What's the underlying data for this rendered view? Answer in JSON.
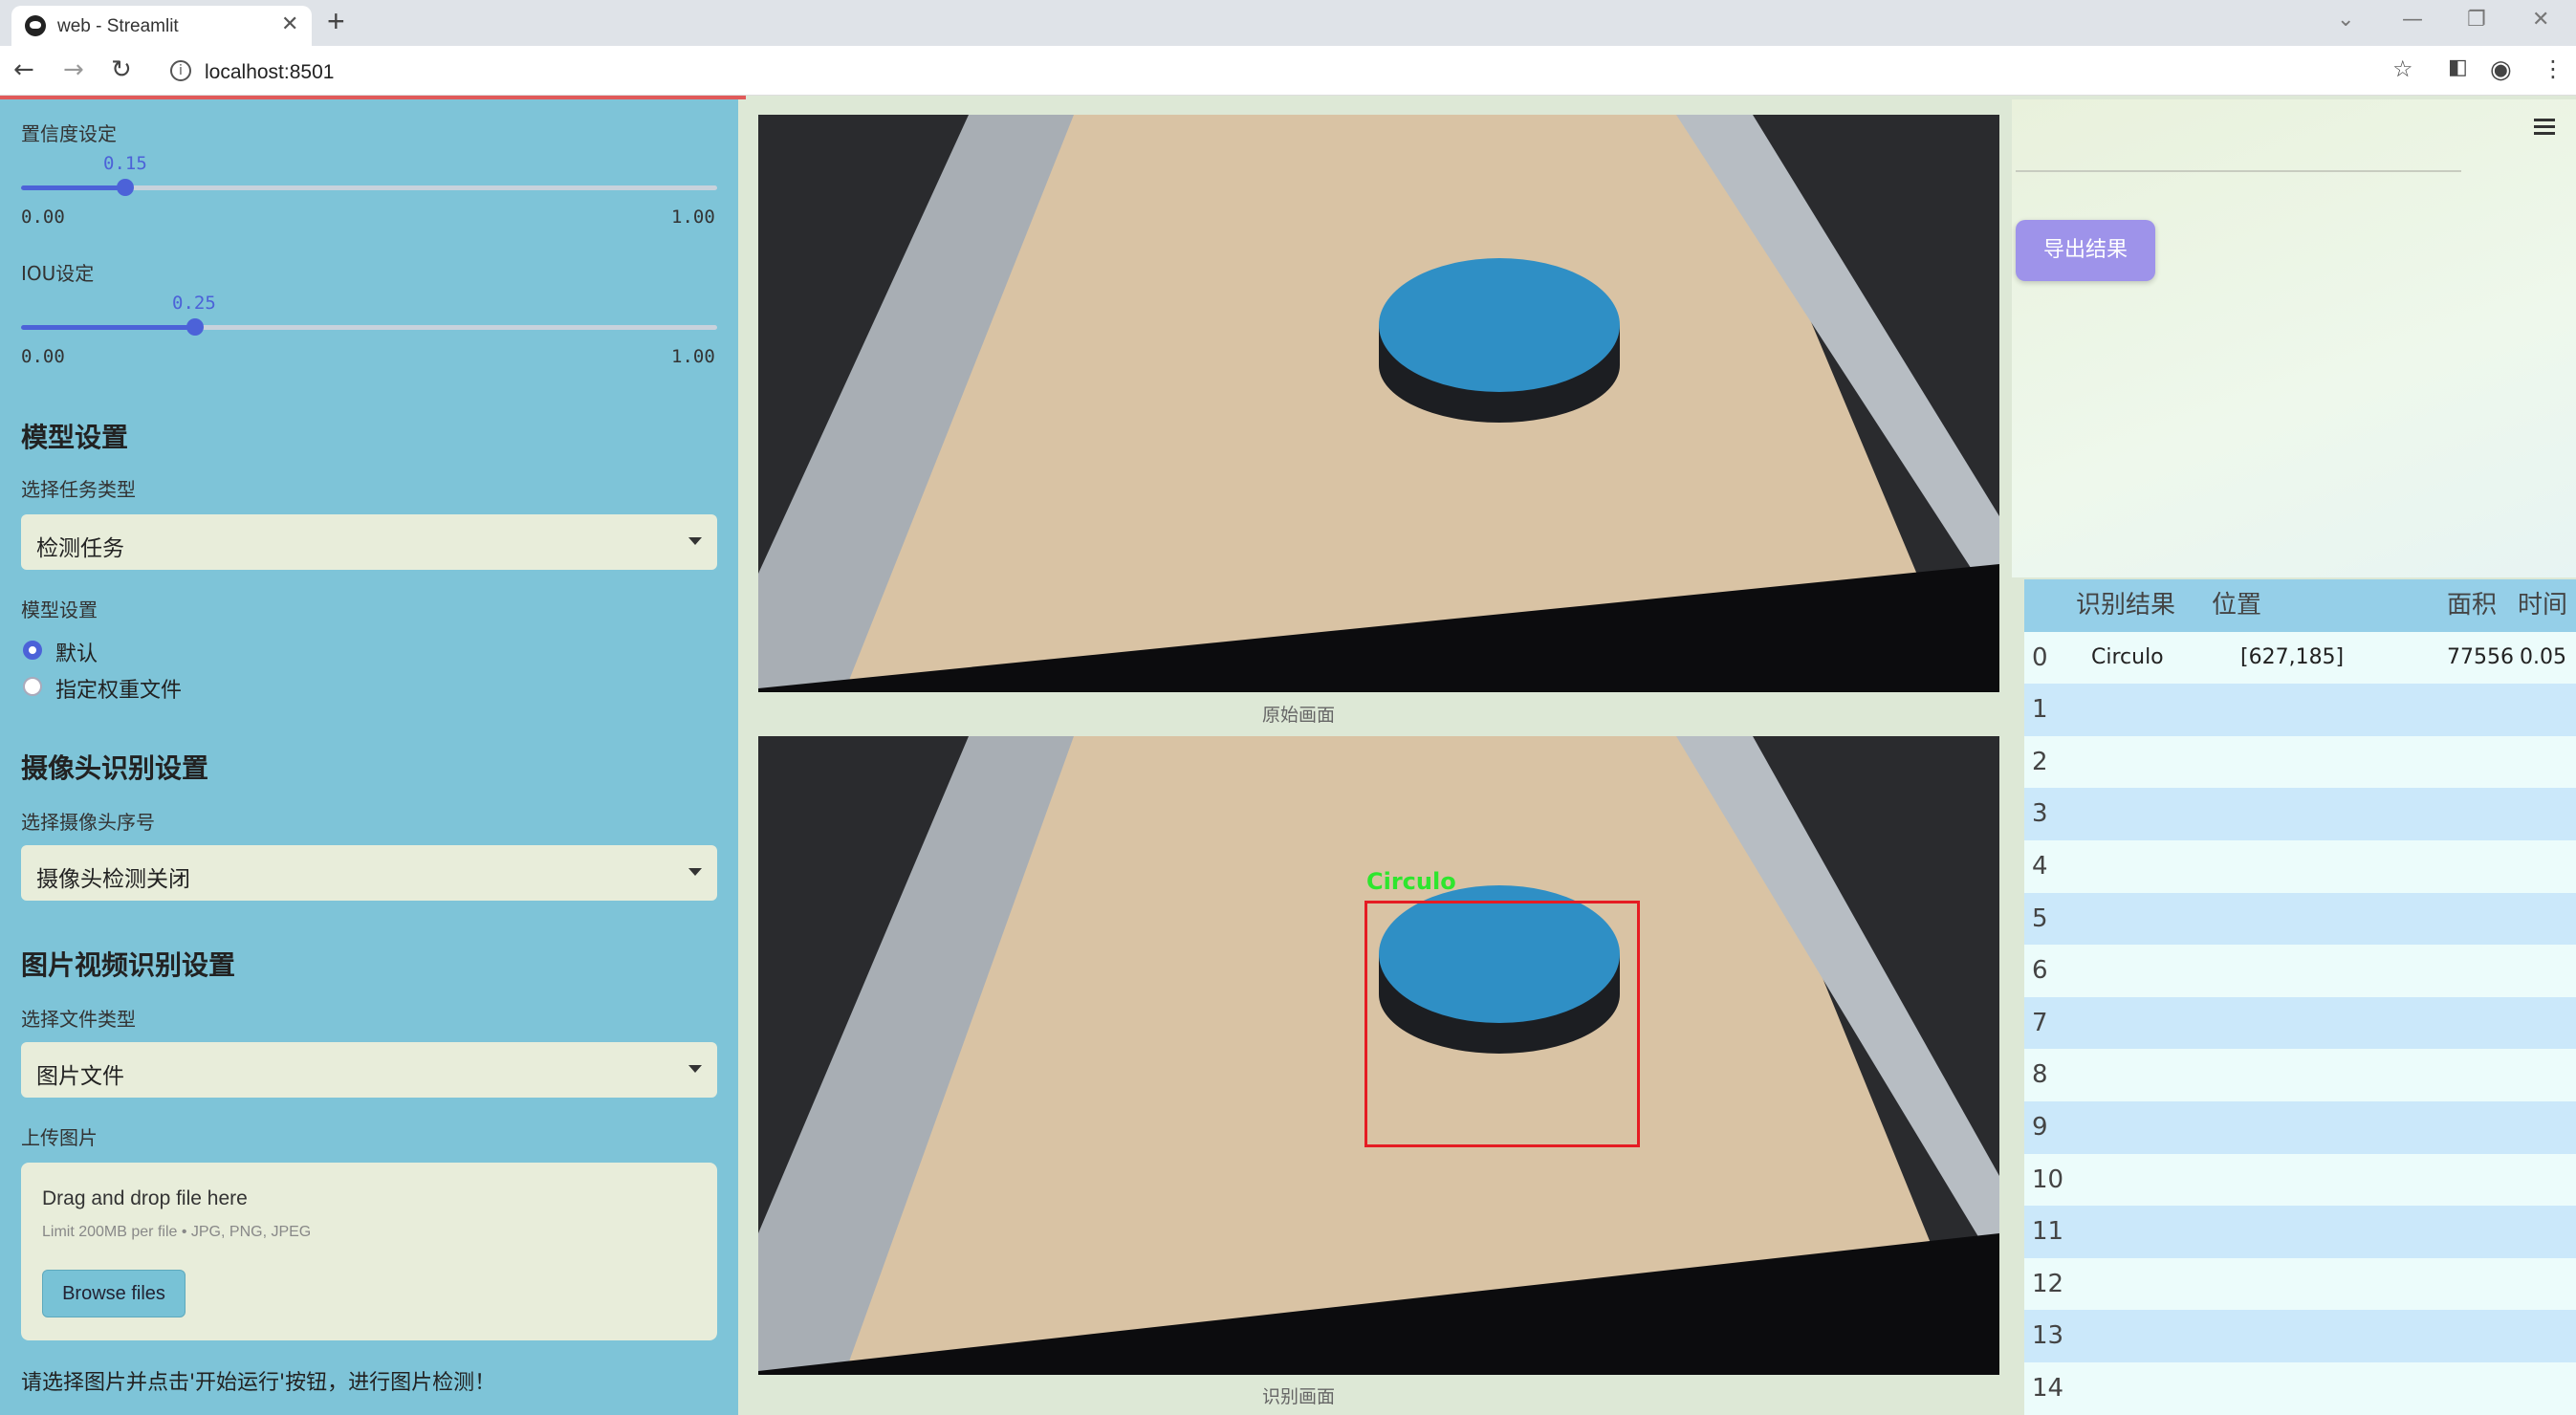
{
  "browser": {
    "tab_title": "web - Streamlit",
    "tab_close": "✕",
    "new_tab": "+",
    "url": "localhost:8501"
  },
  "sidebar": {
    "conf_label": "置信度设定",
    "conf": {
      "value": "0.15",
      "min": "0.00",
      "max": "1.00",
      "fraction": 0.15
    },
    "iou_label": "IOU设定",
    "iou": {
      "value": "0.25",
      "min": "0.00",
      "max": "1.00",
      "fraction": 0.25
    },
    "model_header": "模型设置",
    "task_label": "选择任务类型",
    "task_value": "检测任务",
    "model_label": "模型设置",
    "model_options": [
      "默认",
      "指定权重文件"
    ],
    "model_selected": 0,
    "camera_header": "摄像头识别设置",
    "camera_label": "选择摄像头序号",
    "camera_value": "摄像头检测关闭",
    "file_header": "图片视频识别设置",
    "file_type_label": "选择文件类型",
    "file_type_value": "图片文件",
    "upload_label": "上传图片",
    "upload_title": "Drag and drop file here",
    "upload_limit": "Limit 200MB per file • JPG, PNG, JPEG",
    "browse_label": "Browse files",
    "hint": "请选择图片并点击'开始运行'按钮，进行图片检测！"
  },
  "main": {
    "caption_original": "原始画面",
    "caption_detect": "识别画面",
    "detect_label": "Circulo"
  },
  "right": {
    "export_label": "导出结果"
  },
  "table": {
    "columns": [
      "",
      "识别结果",
      "位置",
      "面积",
      "时间"
    ],
    "rows": [
      {
        "idx": "0",
        "result": "Circulo",
        "pos": "[627,185]",
        "area": "77556",
        "time": "0.05"
      },
      {
        "idx": "1"
      },
      {
        "idx": "2"
      },
      {
        "idx": "3"
      },
      {
        "idx": "4"
      },
      {
        "idx": "5"
      },
      {
        "idx": "6"
      },
      {
        "idx": "7"
      },
      {
        "idx": "8"
      },
      {
        "idx": "9"
      },
      {
        "idx": "10"
      },
      {
        "idx": "11"
      },
      {
        "idx": "12"
      },
      {
        "idx": "13"
      },
      {
        "idx": "14"
      }
    ]
  }
}
